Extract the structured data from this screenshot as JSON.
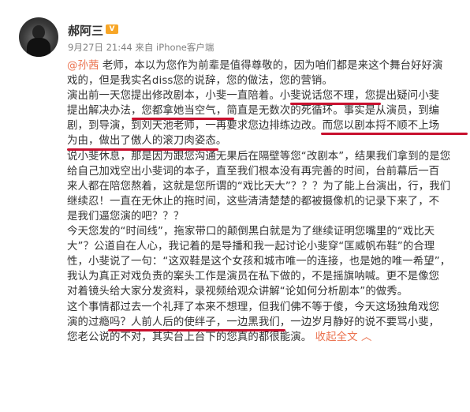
{
  "author": {
    "name": "郝阿三",
    "badge": "V",
    "time": "9月27日 21:44",
    "source": "来自 iPhone客户端"
  },
  "post": {
    "lines": [
      [
        {
          "t": "@孙茜",
          "c": "mention"
        },
        {
          "t": " 老师，本以为您作为前辈是值得尊敬的，因为咱们都是来这个舞台好好演"
        }
      ],
      [
        {
          "t": "戏的，但是我实名diss您的说辞，您的做法，您的营销。"
        }
      ],
      [
        {
          "t": "演出前一天您提出修改剧本，小斐一直陪着。小斐说话您不理，您提出疑问小斐"
        }
      ],
      [
        {
          "t": "提出解决办法，您都拿她当空气，简直是无数次的死循环。事实是从演员，到编"
        }
      ],
      [
        {
          "t": "剧，到导演，到刘天池老师，一再要求您边排练边改。而您以剧本捋不顺不上场"
        }
      ],
      [
        {
          "t": "为由，做出了傲人的滚刀肉姿态。"
        }
      ],
      [
        {
          "t": "说小斐休息，那是因为跟您沟通无果后在隔壁等您“改剧本”，结果我们拿到的是您"
        }
      ],
      [
        {
          "t": "给自己加戏空出小斐词的本子，直至我们根本没有再完善的时间，台前幕后一百"
        }
      ],
      [
        {
          "t": "来人都在陪您熬着，这就是您所谓的“戏比天大”？？？为了能上台演出，行，我们"
        }
      ],
      [
        {
          "t": "继续忍！一直在无休止的拖时间，这些清清楚楚的都被摄像机的记录下来了，不"
        }
      ],
      [
        {
          "t": "是我们逼您演的吧？？？"
        }
      ],
      [
        {
          "t": "今天您发的“时间线”，拖家带口的颠倒黑白就是为了继续证明您嘴里的“戏比天"
        }
      ],
      [
        {
          "t": "大”？公道自在人心，我记着的是导播和我一起讨论小斐穿“匡威帆布鞋”的合理"
        }
      ],
      [
        {
          "t": "性，小斐说了一句：“这双鞋是这个女孩和城市唯一的连接，也是她的唯一希望”，"
        }
      ],
      [
        {
          "t": "我认为真正对戏负责的案头工作是演员在私下做的，不是摇旗呐喊。更不是像您"
        }
      ],
      [
        {
          "t": "对着镜头给大家分发资料，录视频给观众讲解“论如何分析剧本”的做秀。"
        }
      ],
      [
        {
          "t": "这个事情都过去一个礼拜了本来不想理，但我们佛不等于傻，今天这场独角戏您"
        }
      ],
      [
        {
          "t": "演的过瘾吗？人前人后的使绊子，一边黑我们，一边岁月静好的说不要骂小斐，"
        }
      ],
      [
        {
          "t": "您老公说的不对，其实台上台下的您真的都很能演。 "
        },
        {
          "t": "收起全文",
          "c": "collapse"
        },
        {
          "t": " ︿",
          "c": "collapse"
        }
      ]
    ]
  },
  "colors": {
    "mention": "#eb7350",
    "underline": "#c8102e"
  }
}
